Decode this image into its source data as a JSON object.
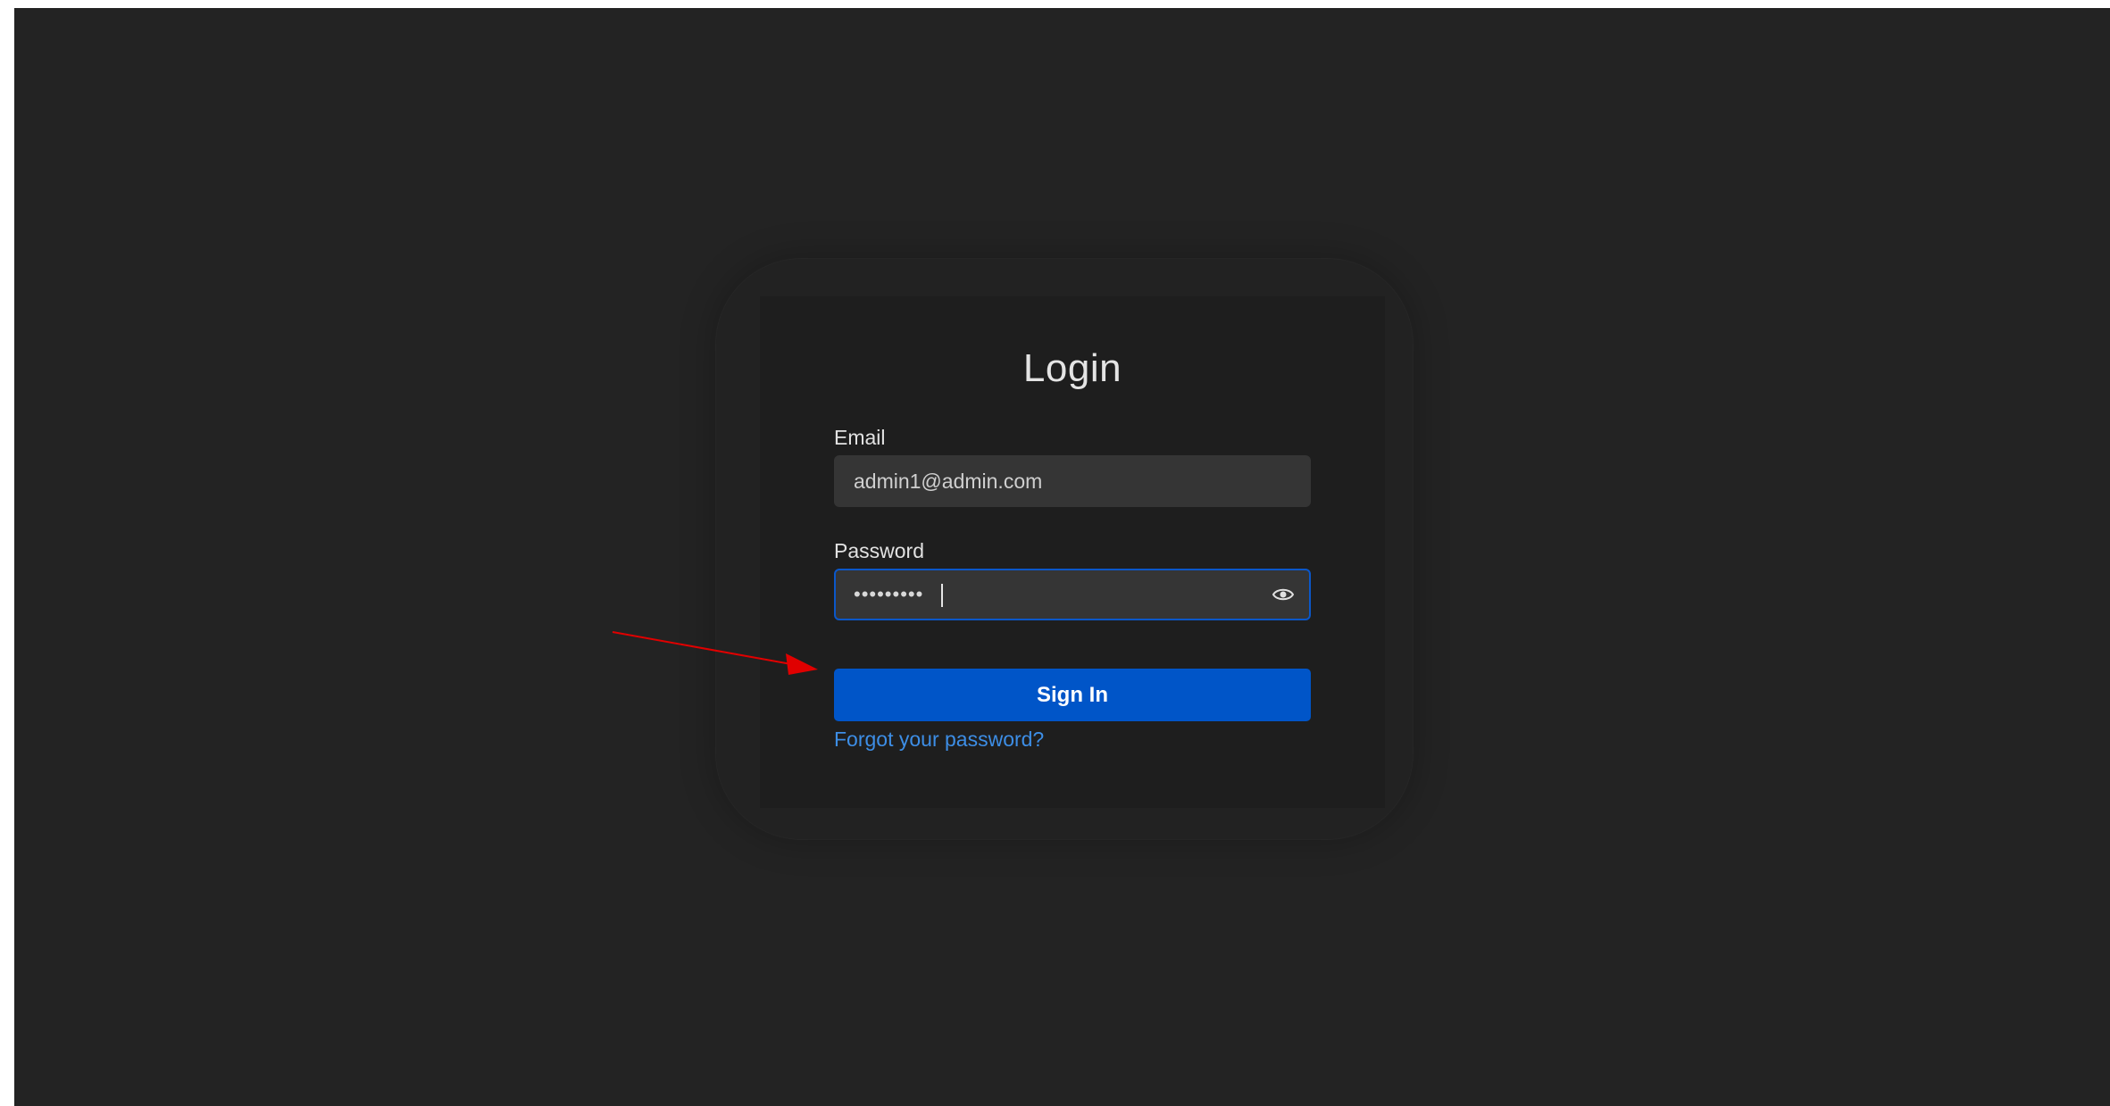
{
  "login": {
    "title": "Login",
    "email_label": "Email",
    "email_value": "admin1@admin.com",
    "password_label": "Password",
    "password_mask": "•••••••••",
    "signin_label": "Sign In",
    "forgot_label": "Forgot your password?"
  },
  "colors": {
    "background": "#232323",
    "card": "#1e1e1e",
    "input": "#353535",
    "primary": "#0055c8",
    "link": "#3d8ee6",
    "annotation_arrow": "#e00000"
  },
  "icons": {
    "password_toggle": "eye-icon",
    "annotation": "arrow-icon"
  }
}
